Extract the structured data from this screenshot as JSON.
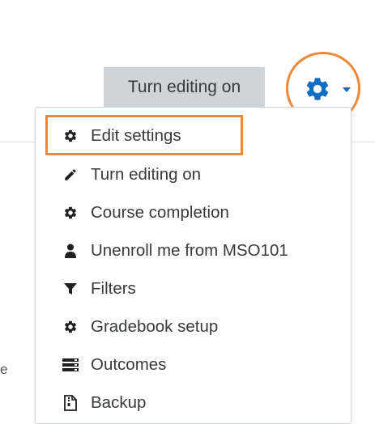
{
  "header": {
    "edit_button_label": "Turn editing on",
    "settings_icon": "gear-icon",
    "toggle_icon": "caret-down-icon"
  },
  "background": {
    "stray_text": "e"
  },
  "menu": {
    "items": [
      {
        "label": "Edit settings",
        "icon": "gear-icon",
        "highlighted": true
      },
      {
        "label": "Turn editing on",
        "icon": "pencil-icon"
      },
      {
        "label": "Course completion",
        "icon": "gear-icon"
      },
      {
        "label": "Unenroll me from MSO101",
        "icon": "user-icon"
      },
      {
        "label": "Filters",
        "icon": "filter-icon"
      },
      {
        "label": "Gradebook setup",
        "icon": "gear-icon"
      },
      {
        "label": "Outcomes",
        "icon": "server-icon"
      },
      {
        "label": "Backup",
        "icon": "file-archive-icon"
      }
    ]
  },
  "colors": {
    "accent_blue": "#0f6cbf",
    "highlight_orange": "#f0883a",
    "button_gray": "#ced4da",
    "text": "#373a3c"
  }
}
